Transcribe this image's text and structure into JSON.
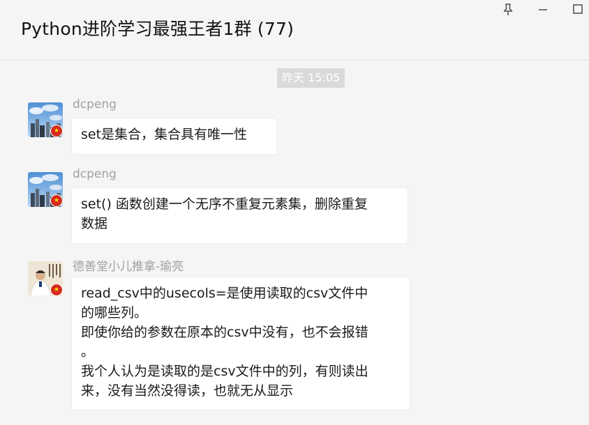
{
  "header": {
    "title": "Python进阶学习最强王者1群 (77)",
    "controls": [
      {
        "icon": "pin-icon"
      },
      {
        "icon": "minimize-icon"
      },
      {
        "icon": "maximize-icon"
      }
    ]
  },
  "time_divider": "昨天 15:05",
  "messages": [
    {
      "sender": "dcpeng",
      "avatar_icon": "city-skyline-avatar",
      "lines": [
        "set是集合，集合具有唯一性"
      ]
    },
    {
      "sender": "dcpeng",
      "avatar_icon": "city-skyline-avatar",
      "lines": [
        "set() 函数创建一个无序不重复元素集，删除重复",
        "数据"
      ]
    },
    {
      "sender": "德善堂小儿推拿-瑜亮",
      "avatar_icon": "person-calligraphy-avatar",
      "lines": [
        "read_csv中的usecols=是使用读取的csv文件中",
        "的哪些列。",
        "即使你给的参数在原本的csv中没有，也不会报错",
        "。",
        "我个人认为是读取的是csv文件中的列，有则读出",
        "来，没有当然没得读，也就无从显示"
      ]
    }
  ],
  "colors": {
    "background": "#f5f5f5",
    "bubble": "#ffffff",
    "sender_text": "#a0a0a0",
    "time_chip": "#dadada",
    "flag_red": "#d52a1e"
  }
}
